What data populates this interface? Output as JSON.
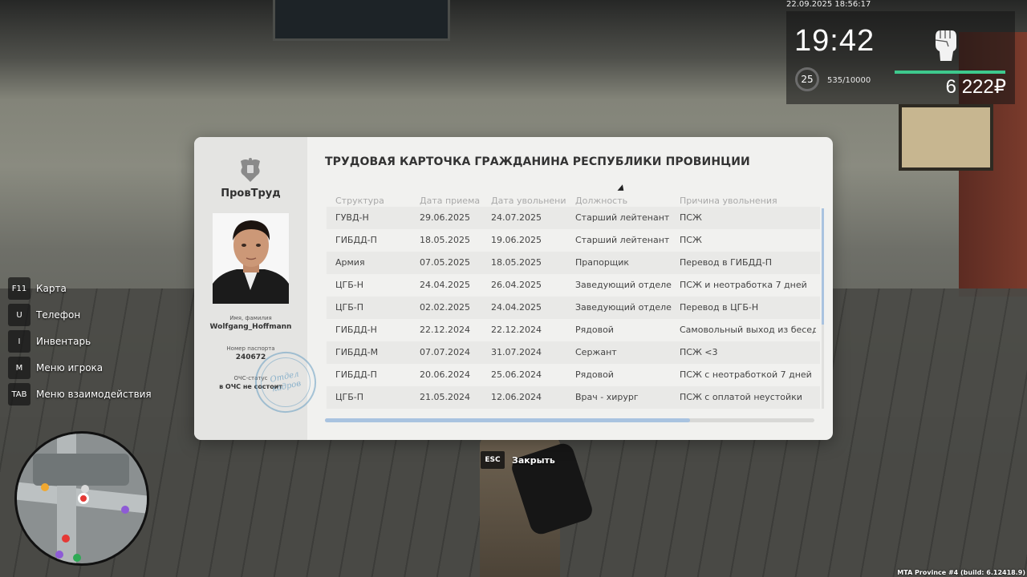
{
  "hud": {
    "datetime": "22.09.2025 18:56:17",
    "clock": "19:42",
    "level": "25",
    "xp": "535/10000",
    "xp_fraction": 0.0535,
    "money": "6 222₽",
    "accent_color": "#3ec98d"
  },
  "keybinds": [
    {
      "key": "F11",
      "label": "Карта"
    },
    {
      "key": "U",
      "label": "Телефон"
    },
    {
      "key": "I",
      "label": "Инвентарь"
    },
    {
      "key": "M",
      "label": "Меню игрока"
    },
    {
      "key": "TAB",
      "label": "Меню взаимодействия"
    }
  ],
  "card": {
    "brand": "ПровТруд",
    "name_label": "Имя, фамилия",
    "name": "Wolfgang_Hoffmann",
    "passport_label": "Номер паспорта",
    "passport": "240672",
    "ochs_label": "ОЧС-статус",
    "ochs_value": "в ОЧС не состоит",
    "stamp_line1": "Отдел",
    "stamp_line2": "кадров",
    "title": "ТРУДОВАЯ КАРТОЧКА ГРАЖДАНИНА РЕСПУБЛИКИ ПРОВИНЦИИ",
    "columns": [
      "Структура",
      "Дата приема",
      "Дата увольнени",
      "Должность",
      "Причина увольнения"
    ],
    "rows": [
      [
        "ГУВД-Н",
        "29.06.2025",
        "24.07.2025",
        "Старший лейтенант",
        "ПСЖ"
      ],
      [
        "ГИБДД-П",
        "18.05.2025",
        "19.06.2025",
        "Старший лейтенант",
        "ПСЖ"
      ],
      [
        "Армия",
        "07.05.2025",
        "18.05.2025",
        "Прапорщик",
        "Перевод в ГИБДД-П"
      ],
      [
        "ЦГБ-Н",
        "24.04.2025",
        "26.04.2025",
        "Заведующий отделе",
        "ПСЖ и неотработка 7 дней"
      ],
      [
        "ЦГБ-П",
        "02.02.2025",
        "24.04.2025",
        "Заведующий отделе",
        "Перевод в ЦГБ-Н"
      ],
      [
        "ГИБДД-Н",
        "22.12.2024",
        "22.12.2024",
        "Рядовой",
        "Самовольный выход из бесед"
      ],
      [
        "ГИБДД-М",
        "07.07.2024",
        "31.07.2024",
        "Сержант",
        "ПСЖ <3"
      ],
      [
        "ГИБДД-П",
        "20.06.2024",
        "25.06.2024",
        "Рядовой",
        "ПСЖ с неотработкой 7 дней"
      ],
      [
        "ЦГБ-П",
        "21.05.2024",
        "12.06.2024",
        "Врач - хирург",
        "ПСЖ с оплатой неустойки"
      ]
    ]
  },
  "close": {
    "key": "ESC",
    "label": "Закрыть"
  },
  "build": "MTA Province #4 (build: 6.12418.9)"
}
